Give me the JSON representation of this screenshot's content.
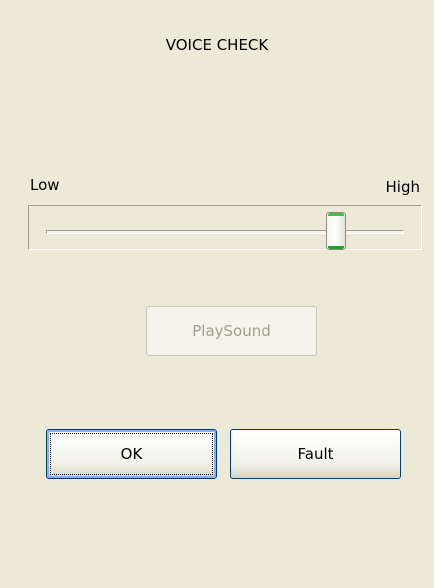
{
  "dialog": {
    "title": "VOICE CHECK"
  },
  "volume_slider": {
    "low_label": "Low",
    "high_label": "High",
    "value_fraction": 0.81
  },
  "buttons": {
    "play_label": "PlaySound",
    "ok_label": "OK",
    "fault_label": "Fault"
  },
  "colors": {
    "background": "#ECE9D8",
    "button_border": "#003C74",
    "focus_ring": "#8AB0E8",
    "disabled_text": "#A19E8E",
    "thumb_accent": "#21A121"
  }
}
